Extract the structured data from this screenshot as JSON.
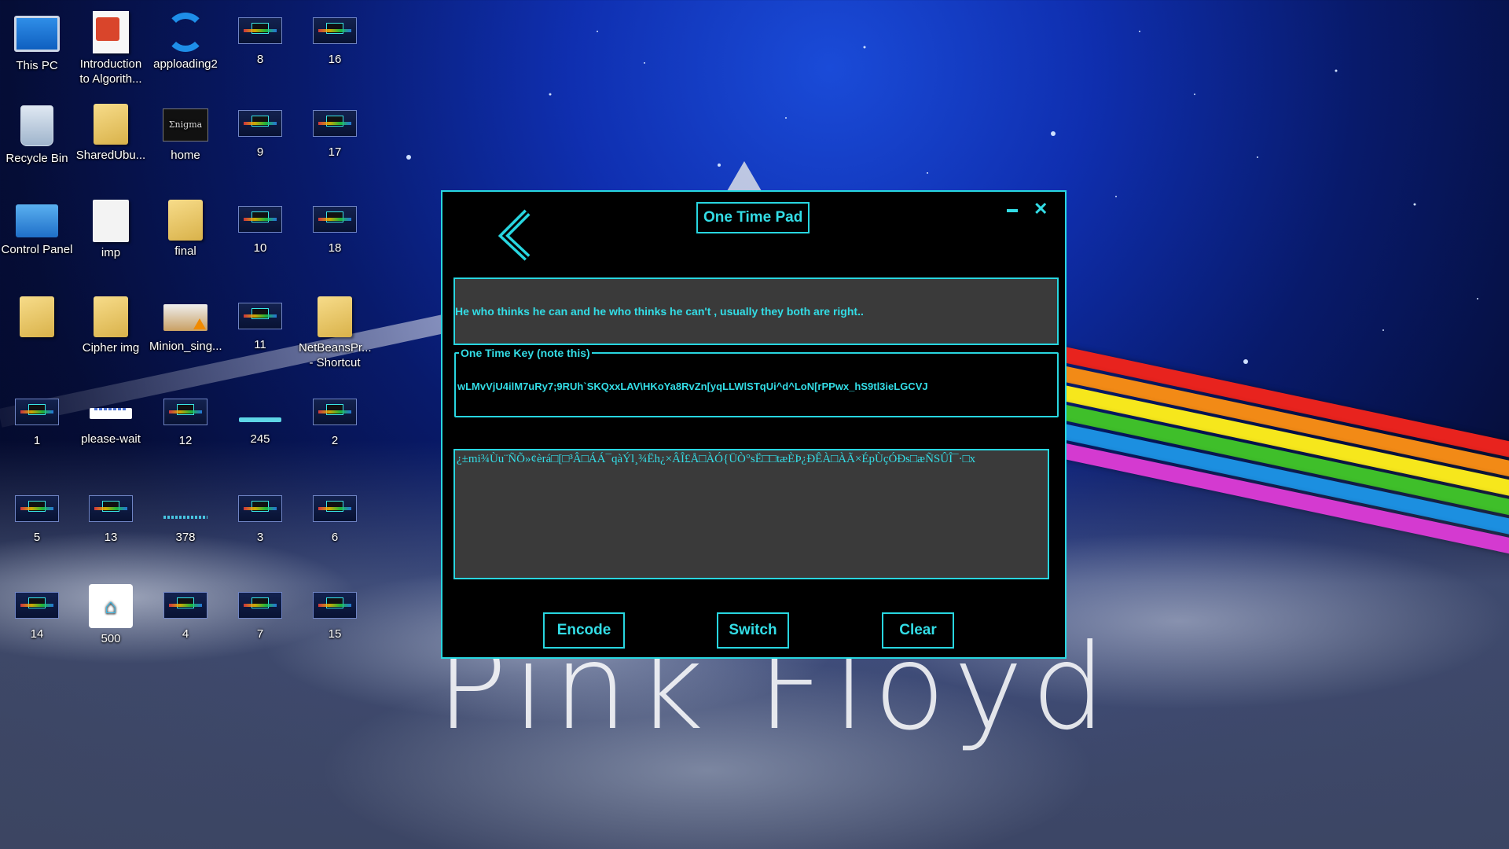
{
  "desktop": {
    "icons": [
      {
        "label": "This PC",
        "kind": "pc-icon"
      },
      {
        "label": "Introduction to Algorith...",
        "kind": "pdf-icon"
      },
      {
        "label": "apploading2",
        "kind": "sync-icon"
      },
      {
        "label": "8",
        "kind": "thumbnail-icon"
      },
      {
        "label": "16",
        "kind": "thumbnail-icon"
      },
      {
        "label": "Recycle Bin",
        "kind": "recycle-bin-icon"
      },
      {
        "label": "SharedUbu...",
        "kind": "folder-icon"
      },
      {
        "label": "home",
        "kind": "enigma-thumbnail-icon"
      },
      {
        "label": "9",
        "kind": "thumbnail-icon"
      },
      {
        "label": "17",
        "kind": "thumbnail-icon"
      },
      {
        "label": "Control Panel",
        "kind": "control-panel-icon"
      },
      {
        "label": "imp",
        "kind": "document-icon"
      },
      {
        "label": "final",
        "kind": "folder-icon"
      },
      {
        "label": "10",
        "kind": "thumbnail-icon"
      },
      {
        "label": "18",
        "kind": "thumbnail-icon"
      },
      {
        "label": "",
        "kind": "folder-icon"
      },
      {
        "label": "Cipher img",
        "kind": "folder-icon"
      },
      {
        "label": "Minion_sing...",
        "kind": "video-icon"
      },
      {
        "label": "11",
        "kind": "thumbnail-icon"
      },
      {
        "label": "NetBeansPr... - Shortcut",
        "kind": "folder-shortcut-icon"
      },
      {
        "label": "1",
        "kind": "thumbnail-icon"
      },
      {
        "label": "please-wait",
        "kind": "please-wait-icon"
      },
      {
        "label": "12",
        "kind": "thumbnail-icon"
      },
      {
        "label": "245",
        "kind": "bar-image-icon"
      },
      {
        "label": "2",
        "kind": "thumbnail-icon"
      },
      {
        "label": "5",
        "kind": "thumbnail-icon"
      },
      {
        "label": "13",
        "kind": "thumbnail-icon"
      },
      {
        "label": "378",
        "kind": "dotted-bar-image-icon"
      },
      {
        "label": "3",
        "kind": "thumbnail-icon"
      },
      {
        "label": "6",
        "kind": "thumbnail-icon"
      },
      {
        "label": "14",
        "kind": "thumbnail-icon"
      },
      {
        "label": "500",
        "kind": "app-image-icon"
      },
      {
        "label": "4",
        "kind": "thumbnail-icon"
      },
      {
        "label": "7",
        "kind": "thumbnail-icon"
      },
      {
        "label": "15",
        "kind": "thumbnail-icon"
      }
    ],
    "wallpaper_text": "Pink Floyd"
  },
  "app": {
    "title": "One Time Pad",
    "back_icon": "chevron-left-icon",
    "minimize_icon": "minimize-icon",
    "close_glyph": "✕",
    "input_text": "He who thinks he can and he who thinks he can't , usually they both are right..",
    "key_legend": "One Time Key (note this)",
    "key_value": "wLMvVjU4ilM7uRy7;9RUh`SKQxxLAV\\HKoYa8RvZn[yqLLWlSTqUi^d^LoN[rPPwx_hS9tl3ieLGCVJ",
    "output_text": "¿±mi¾Ùu¨ÑÕ»¢èrá□[□³Â□ÁÁ¯qàÝl¸¾Ëh¿×ÂÎ£Å□ÀÓ{ÜÒ°sË□□tæÈÞ¿ÐÊÀ□ÀÃ×ÉpÙçÓÐs□æÑSÛÎ¯·□x",
    "buttons": {
      "encode": "Encode",
      "switch": "Switch",
      "clear": "Clear"
    },
    "colors": {
      "accent": "#28d6e0",
      "background": "#000000",
      "field": "#3a3a3a"
    }
  }
}
